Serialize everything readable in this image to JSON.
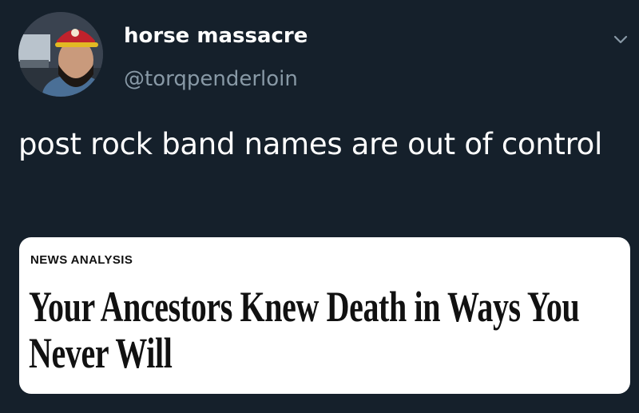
{
  "user": {
    "display_name": "horse massacre",
    "handle": "@torqpenderloin",
    "avatar_icon": "profile-photo-avatar"
  },
  "tweet": {
    "text": "post rock band names are out of control",
    "menu_icon": "chevron-down-icon"
  },
  "card": {
    "kicker": "NEWS ANALYSIS",
    "headline": "Your Ancestors Knew Death in Ways You Never Will"
  },
  "colors": {
    "background": "#15202b",
    "primary_text": "#ffffff",
    "secondary_text": "#8899a6",
    "card_background": "#ffffff",
    "card_text": "#111111"
  }
}
